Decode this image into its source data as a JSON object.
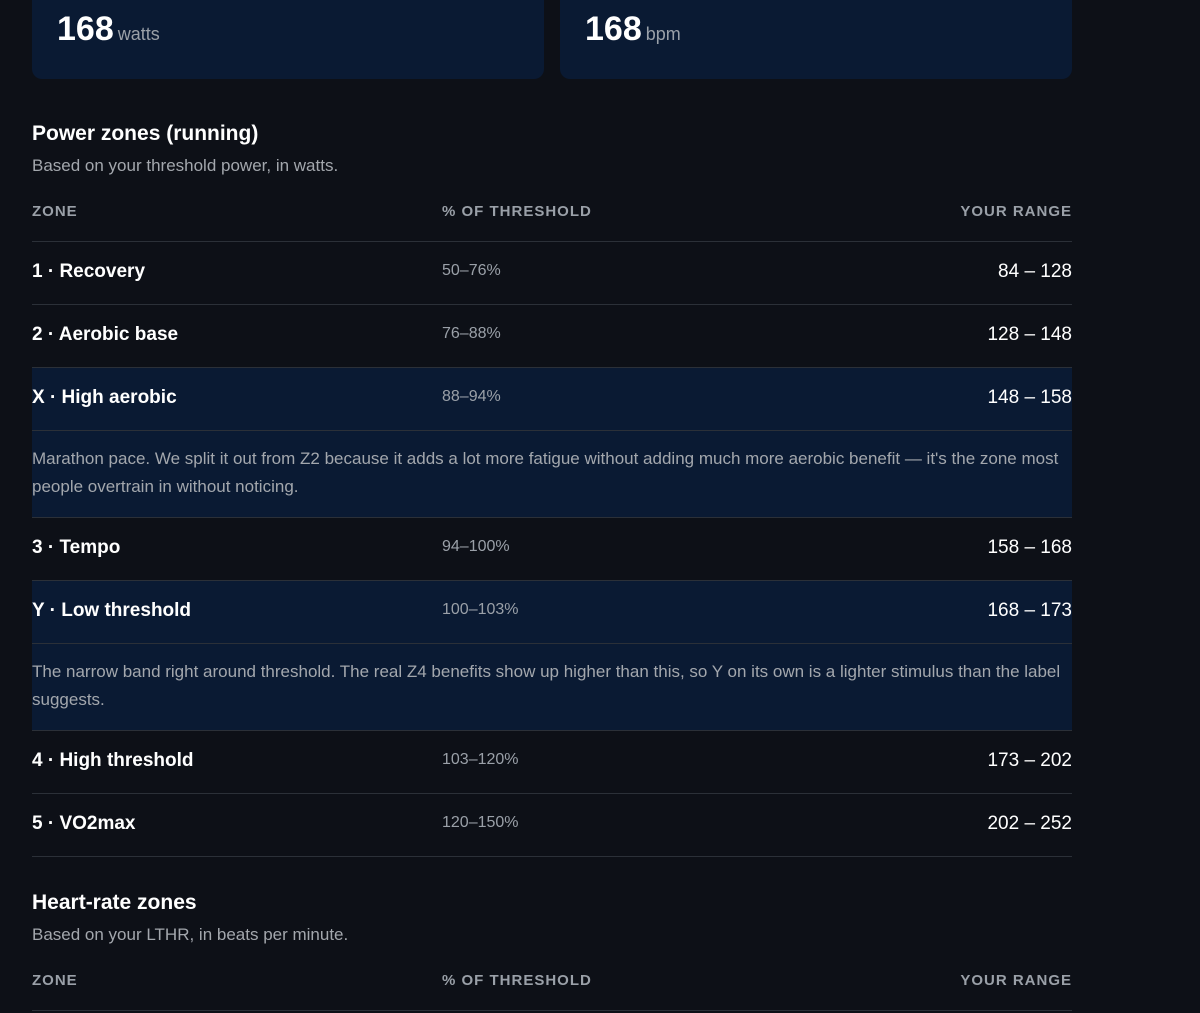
{
  "metrics": [
    {
      "value": "168",
      "unit": "watts"
    },
    {
      "value": "168",
      "unit": "bpm"
    }
  ],
  "power_section": {
    "title": "Power zones (running)",
    "subtitle": "Based on your threshold power, in watts.",
    "headers": {
      "zone": "ZONE",
      "pct": "% OF THRESHOLD",
      "range": "YOUR RANGE"
    },
    "rows": [
      {
        "name": "1 · Recovery",
        "pct": "50–76%",
        "range": "84 – 128",
        "highlight": false
      },
      {
        "name": "2 · Aerobic base",
        "pct": "76–88%",
        "range": "128 – 148",
        "highlight": false
      },
      {
        "name": "X · High aerobic",
        "pct": "88–94%",
        "range": "148 – 158",
        "highlight": true,
        "note": "Marathon pace. We split it out from Z2 because it adds a lot more fatigue without adding much more aerobic benefit — it's the zone most people overtrain in without noticing."
      },
      {
        "name": "3 · Tempo",
        "pct": "94–100%",
        "range": "158 – 168",
        "highlight": false
      },
      {
        "name": "Y · Low threshold",
        "pct": "100–103%",
        "range": "168 – 173",
        "highlight": true,
        "note": "The narrow band right around threshold. The real Z4 benefits show up higher than this, so Y on its own is a lighter stimulus than the label suggests."
      },
      {
        "name": "4 · High threshold",
        "pct": "103–120%",
        "range": "173 – 202",
        "highlight": false
      },
      {
        "name": "5 · VO2max",
        "pct": "120–150%",
        "range": "202 – 252",
        "highlight": false
      }
    ]
  },
  "hr_section": {
    "title": "Heart-rate zones",
    "subtitle": "Based on your LTHR, in beats per minute.",
    "headers": {
      "zone": "ZONE",
      "pct": "% OF THRESHOLD",
      "range": "YOUR RANGE"
    }
  },
  "colors": {
    "background": "#0d1017",
    "card": "#0a1a33",
    "highlight_row": "#0a1a33",
    "muted_text": "#9aa0a8",
    "divider": "#2b3038"
  }
}
